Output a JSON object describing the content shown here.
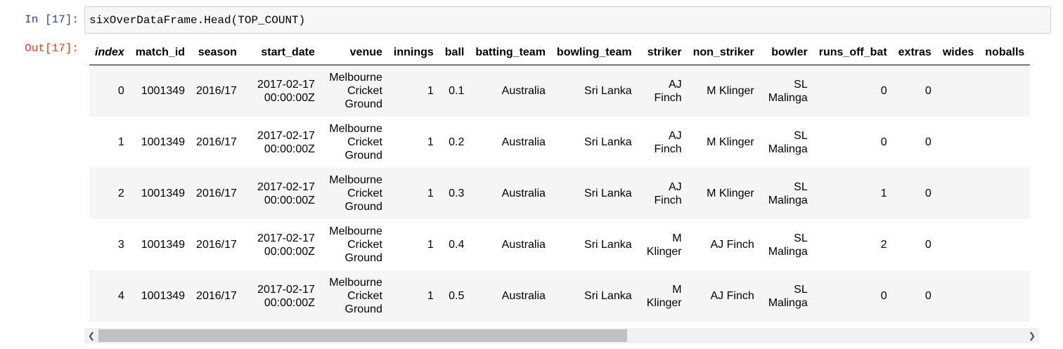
{
  "cell": {
    "in_prompt": "In [17]:",
    "out_prompt": "Out[17]:",
    "code": "sixOverDataFrame.Head(TOP_COUNT)"
  },
  "table": {
    "columns": [
      "index",
      "match_id",
      "season",
      "start_date",
      "venue",
      "innings",
      "ball",
      "batting_team",
      "bowling_team",
      "striker",
      "non_striker",
      "bowler",
      "runs_off_bat",
      "extras",
      "wides",
      "noballs"
    ],
    "rows": [
      {
        "index": "0",
        "match_id": "1001349",
        "season": "2016/17",
        "start_date": "2017-02-17 00:00:00Z",
        "venue": "Melbourne Cricket Ground",
        "innings": "1",
        "ball": "0.1",
        "batting_team": "Australia",
        "bowling_team": "Sri Lanka",
        "striker": "AJ Finch",
        "non_striker": "M Klinger",
        "bowler": "SL Malinga",
        "runs_off_bat": "0",
        "extras": "0",
        "wides": "",
        "noballs": ""
      },
      {
        "index": "1",
        "match_id": "1001349",
        "season": "2016/17",
        "start_date": "2017-02-17 00:00:00Z",
        "venue": "Melbourne Cricket Ground",
        "innings": "1",
        "ball": "0.2",
        "batting_team": "Australia",
        "bowling_team": "Sri Lanka",
        "striker": "AJ Finch",
        "non_striker": "M Klinger",
        "bowler": "SL Malinga",
        "runs_off_bat": "0",
        "extras": "0",
        "wides": "",
        "noballs": ""
      },
      {
        "index": "2",
        "match_id": "1001349",
        "season": "2016/17",
        "start_date": "2017-02-17 00:00:00Z",
        "venue": "Melbourne Cricket Ground",
        "innings": "1",
        "ball": "0.3",
        "batting_team": "Australia",
        "bowling_team": "Sri Lanka",
        "striker": "AJ Finch",
        "non_striker": "M Klinger",
        "bowler": "SL Malinga",
        "runs_off_bat": "1",
        "extras": "0",
        "wides": "",
        "noballs": ""
      },
      {
        "index": "3",
        "match_id": "1001349",
        "season": "2016/17",
        "start_date": "2017-02-17 00:00:00Z",
        "venue": "Melbourne Cricket Ground",
        "innings": "1",
        "ball": "0.4",
        "batting_team": "Australia",
        "bowling_team": "Sri Lanka",
        "striker": "M Klinger",
        "non_striker": "AJ Finch",
        "bowler": "SL Malinga",
        "runs_off_bat": "2",
        "extras": "0",
        "wides": "",
        "noballs": ""
      },
      {
        "index": "4",
        "match_id": "1001349",
        "season": "2016/17",
        "start_date": "2017-02-17 00:00:00Z",
        "venue": "Melbourne Cricket Ground",
        "innings": "1",
        "ball": "0.5",
        "batting_team": "Australia",
        "bowling_team": "Sri Lanka",
        "striker": "M Klinger",
        "non_striker": "AJ Finch",
        "bowler": "SL Malinga",
        "runs_off_bat": "0",
        "extras": "0",
        "wides": "",
        "noballs": ""
      }
    ]
  },
  "scrollbar": {
    "left_icon": "arrow-left-icon",
    "right_icon": "arrow-right-icon",
    "left_glyph": "❮",
    "right_glyph": "❯"
  },
  "colors": {
    "in_prompt": "#303f9f",
    "out_prompt": "#d84315",
    "row_stripe": "#f5f5f5"
  }
}
